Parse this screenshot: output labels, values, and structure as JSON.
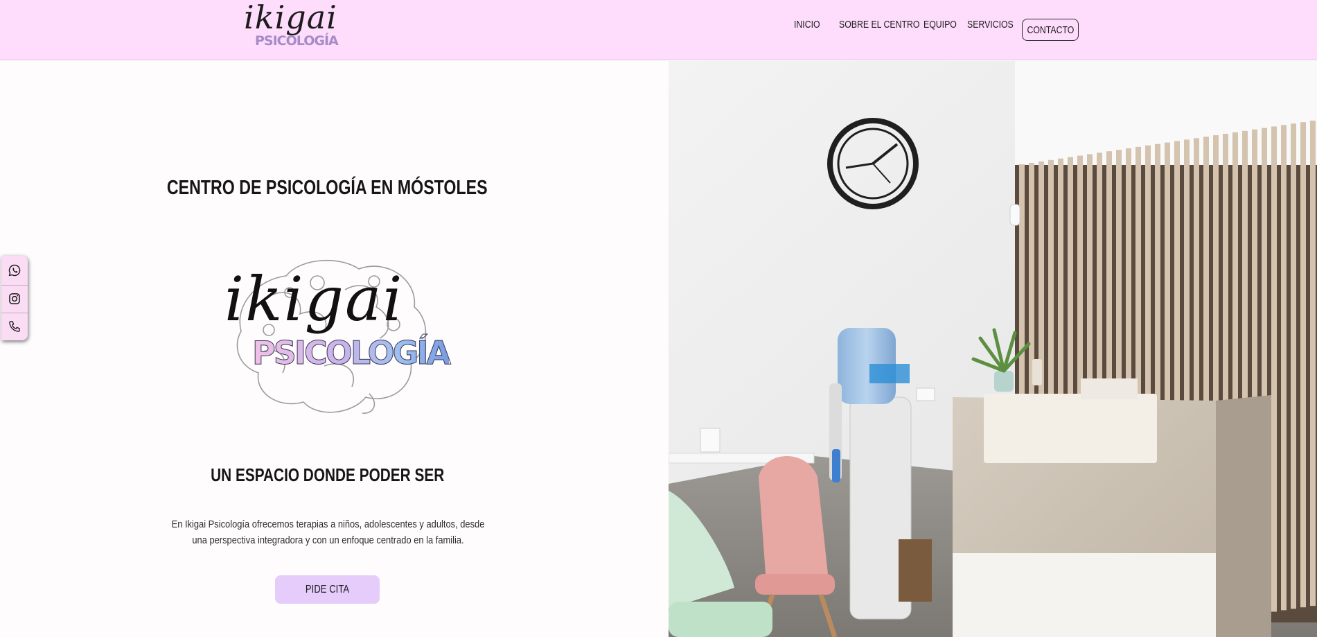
{
  "header": {
    "logo_script": "ikigai",
    "logo_word": "PSICOLOGÍA",
    "nav": [
      "INICIO",
      "SOBRE EL CENTRO",
      "EQUIPO",
      "SERVICIOS"
    ],
    "contact_label": "CONTACTO"
  },
  "hero": {
    "heading": "CENTRO DE PSICOLOGÍA EN MÓSTOLES",
    "logo_script": "ikigai",
    "logo_word": "PSICOLOGÍA",
    "subheading": "UN ESPACIO DONDE PODER SER",
    "description": "En Ikigai Psicología ofrecemos terapias a niños, adolescentes y adultos, desde una perspectiva integradora y con un enfoque centrado en la familia.",
    "cta_label": "PIDE CITA"
  },
  "social": [
    "whatsapp-icon",
    "instagram-icon",
    "phone-icon"
  ],
  "colors": {
    "header_bg": "#fedcfb",
    "cta_bg": "#e5ccfb",
    "social_bg": "#fadcf4",
    "logo_gradient": [
      "#f2c2e6",
      "#c9b3ea",
      "#9ec0ef",
      "#7a9be0"
    ]
  }
}
